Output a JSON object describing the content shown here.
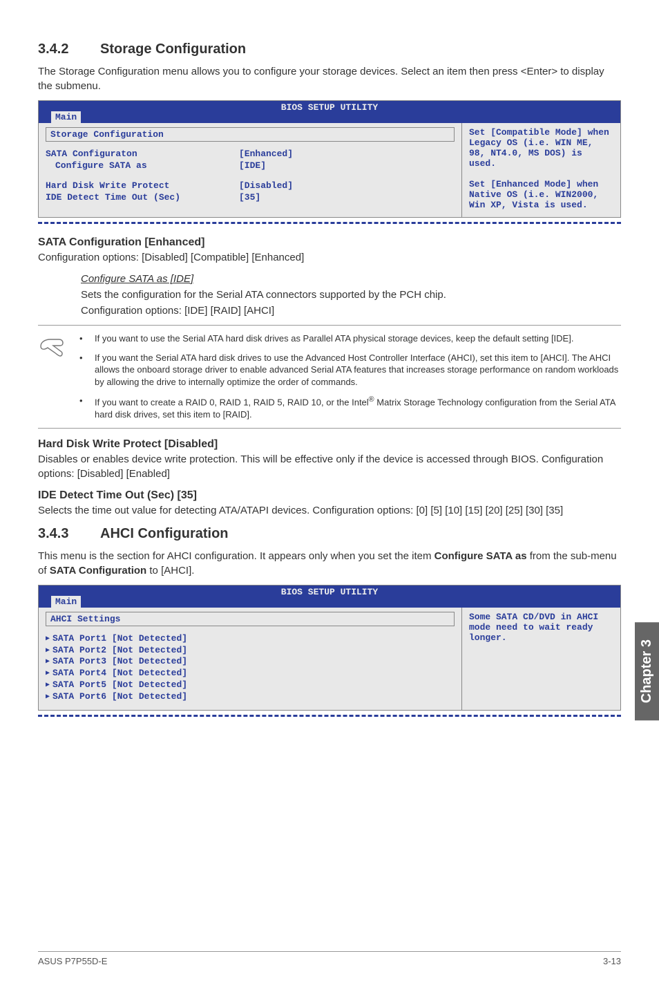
{
  "section_342": {
    "number": "3.4.2",
    "title": "Storage Configuration",
    "intro": "The Storage Configuration menu allows you to configure your storage devices. Select an item then press <Enter> to display the submenu."
  },
  "bios1": {
    "header_title": "BIOS SETUP UTILITY",
    "tab": "Main",
    "box_title": "Storage Configuration",
    "rows": [
      {
        "label": "SATA Configuraton",
        "value": "[Enhanced]"
      },
      {
        "label": "Configure SATA as",
        "value": "[IDE]"
      }
    ],
    "rows2": [
      {
        "label": "Hard Disk Write Protect",
        "value": "[Disabled]"
      },
      {
        "label": "IDE Detect Time Out (Sec)",
        "value": "[35]"
      }
    ],
    "help": "Set [Compatible Mode] when Legacy OS (i.e. WIN ME, 98, NT4.0, MS DOS) is used.\n\nSet [Enhanced Mode] when Native OS (i.e. WIN2000, Win XP, Vista is used."
  },
  "sata_cfg": {
    "heading": "SATA Configuration [Enhanced]",
    "body": "Configuration options: [Disabled] [Compatible] [Enhanced]",
    "sub_heading": "Configure SATA as [IDE]",
    "sub_body1": "Sets the configuration for the Serial ATA connectors supported by the PCH chip.",
    "sub_body2": "Configuration options: [IDE] [RAID] [AHCI]"
  },
  "notes": {
    "b1": "If you want to use the Serial ATA hard disk drives as Parallel ATA physical storage devices, keep the default setting [IDE].",
    "b2": "If you want the Serial ATA hard disk drives to use the Advanced Host Controller Interface (AHCI), set this item to [AHCI]. The AHCI allows the onboard storage driver to enable advanced Serial ATA features that increases storage performance on random workloads by allowing the drive to internally optimize the order of commands.",
    "b3_pre": "If you want to create a RAID 0, RAID 1, RAID 5, RAID 10, or the Intel",
    "b3_sup": "®",
    "b3_post": " Matrix Storage Technology configuration from the Serial ATA hard disk drives, set this item to [RAID]."
  },
  "hdwp": {
    "heading": "Hard Disk Write Protect [Disabled]",
    "body": "Disables or enables device write protection. This will be effective only if the device is accessed through BIOS. Configuration options: [Disabled] [Enabled]"
  },
  "ide_to": {
    "heading": "IDE Detect Time Out (Sec) [35]",
    "body": "Selects the time out value for detecting ATA/ATAPI devices. Configuration options: [0] [5] [10] [15] [20] [25] [30] [35]"
  },
  "section_343": {
    "number": "3.4.3",
    "title": "AHCI Configuration",
    "intro_pre": "This menu is the section for AHCI configuration. It appears only when you set the item ",
    "intro_bold1": "Configure SATA as",
    "intro_mid": " from the sub-menu of ",
    "intro_bold2": "SATA Configuration",
    "intro_post": " to [AHCI]."
  },
  "bios2": {
    "header_title": "BIOS SETUP UTILITY",
    "tab": "Main",
    "box_title": "AHCI Settings",
    "items": [
      "SATA Port1 [Not Detected]",
      "SATA Port2 [Not Detected]",
      "SATA Port3 [Not Detected]",
      "SATA Port4 [Not Detected]",
      "SATA Port5 [Not Detected]",
      "SATA Port6 [Not Detected]"
    ],
    "help": "Some SATA CD/DVD in AHCI mode need to wait ready longer."
  },
  "chapter_tab": "Chapter 3",
  "footer": {
    "left": "ASUS P7P55D-E",
    "right": "3-13"
  }
}
